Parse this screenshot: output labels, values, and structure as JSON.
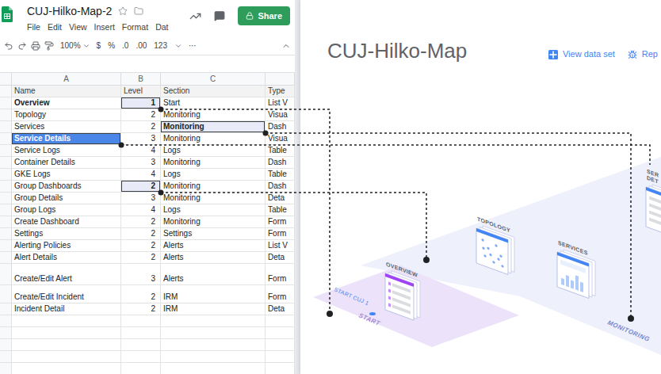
{
  "sheet": {
    "title": "CUJ-Hilko-Map-2",
    "menu": [
      "File",
      "Edit",
      "View",
      "Insert",
      "Format",
      "Dat"
    ],
    "share": "Share",
    "zoom": "100%",
    "formats": [
      "$",
      "%",
      ".0",
      ".00",
      "123"
    ],
    "more": "⋯",
    "column_letters": [
      "A",
      "B",
      "C"
    ],
    "columns": [
      "Name",
      "Level",
      "Section",
      "Type"
    ],
    "rows": [
      {
        "name": "Overview",
        "level": "1",
        "section": "Start",
        "type": "List V",
        "kind": "normal",
        "bold": true,
        "selected": false,
        "level_marked": true,
        "section_marked": false
      },
      {
        "name": "Topology",
        "level": "2",
        "section": "Monitoring",
        "type": "Visua",
        "kind": "normal",
        "bold": false,
        "selected": false,
        "level_marked": false,
        "section_marked": false
      },
      {
        "name": "Services",
        "level": "2",
        "section": "Monitoring",
        "type": "Dash",
        "kind": "normal",
        "bold": false,
        "selected": false,
        "level_marked": false,
        "section_marked": true
      },
      {
        "name": "Service Details",
        "level": "3",
        "section": "Monitoring",
        "type": "Visua",
        "kind": "normal",
        "bold": false,
        "selected": true,
        "level_marked": false,
        "section_marked": false
      },
      {
        "name": "Service Logs",
        "level": "4",
        "section": "Logs",
        "type": "Table",
        "kind": "normal",
        "bold": false,
        "selected": false,
        "level_marked": false,
        "section_marked": false
      },
      {
        "name": "Container Details",
        "level": "3",
        "section": "Monitoring",
        "type": "Dash",
        "kind": "normal",
        "bold": false,
        "selected": false,
        "level_marked": false,
        "section_marked": false
      },
      {
        "name": "GKE Logs",
        "level": "4",
        "section": "Logs",
        "type": "Table",
        "kind": "normal",
        "bold": false,
        "selected": false,
        "level_marked": false,
        "section_marked": false
      },
      {
        "name": "Group Dashboards",
        "level": "2",
        "section": "Monitoring",
        "type": "Dash",
        "kind": "normal",
        "bold": false,
        "selected": false,
        "level_marked": true,
        "section_marked": false
      },
      {
        "name": "Group Details",
        "level": "3",
        "section": "Monitoring",
        "type": "Deta",
        "kind": "normal",
        "bold": false,
        "selected": false,
        "level_marked": false,
        "section_marked": false
      },
      {
        "name": "Group Logs",
        "level": "4",
        "section": "Logs",
        "type": "Table",
        "kind": "normal",
        "bold": false,
        "selected": false,
        "level_marked": false,
        "section_marked": false
      },
      {
        "name": "Create Dashboard",
        "level": "2",
        "section": "Monitoring",
        "type": "Form",
        "kind": "normal",
        "bold": false,
        "selected": false,
        "level_marked": false,
        "section_marked": false
      },
      {
        "name": "Settings",
        "level": "2",
        "section": "Settings",
        "type": "Form",
        "kind": "normal",
        "bold": false,
        "selected": false,
        "level_marked": false,
        "section_marked": false
      },
      {
        "name": "Alerting Policies",
        "level": "2",
        "section": "Alerts",
        "type": "List V",
        "kind": "normal",
        "bold": false,
        "selected": false,
        "level_marked": false,
        "section_marked": false
      },
      {
        "name": "Alert Details",
        "level": "2",
        "section": "Alerts",
        "type": "Deta",
        "kind": "normal",
        "bold": false,
        "selected": false,
        "level_marked": false,
        "section_marked": false
      },
      {
        "name": "Create/Edit Alert",
        "level": "3",
        "section": "Alerts",
        "type": "Form",
        "kind": "tall",
        "bold": false,
        "selected": false,
        "level_marked": false,
        "section_marked": false
      },
      {
        "name": "Create/Edit Incident",
        "level": "2",
        "section": "IRM",
        "type": "Form",
        "kind": "raised",
        "bold": false,
        "selected": false,
        "level_marked": false,
        "section_marked": false
      },
      {
        "name": "Incident Detail",
        "level": "2",
        "section": "IRM",
        "type": "Deta",
        "kind": "normal",
        "bold": false,
        "selected": false,
        "level_marked": false,
        "section_marked": false
      }
    ]
  },
  "map": {
    "title": "CUJ-Hilko-Map",
    "actions": [
      {
        "label": "View data set",
        "kind": "data"
      },
      {
        "label": "Rep",
        "kind": "report"
      }
    ],
    "start_label": "START CUJ 1",
    "zones": [
      "START",
      "MONITORING"
    ],
    "nodes": [
      {
        "lines": [
          "OVERVIEW"
        ],
        "kind": "list",
        "color": "#a142f4"
      },
      {
        "lines": [
          "TOPOLOGY"
        ],
        "kind": "scatter",
        "color": "#4285f4"
      },
      {
        "lines": [
          "SERVICES"
        ],
        "kind": "dashboard",
        "color": "#4285f4"
      },
      {
        "lines": [
          "SER",
          "DET"
        ],
        "kind": "detail",
        "color": "#4285f4"
      }
    ]
  }
}
